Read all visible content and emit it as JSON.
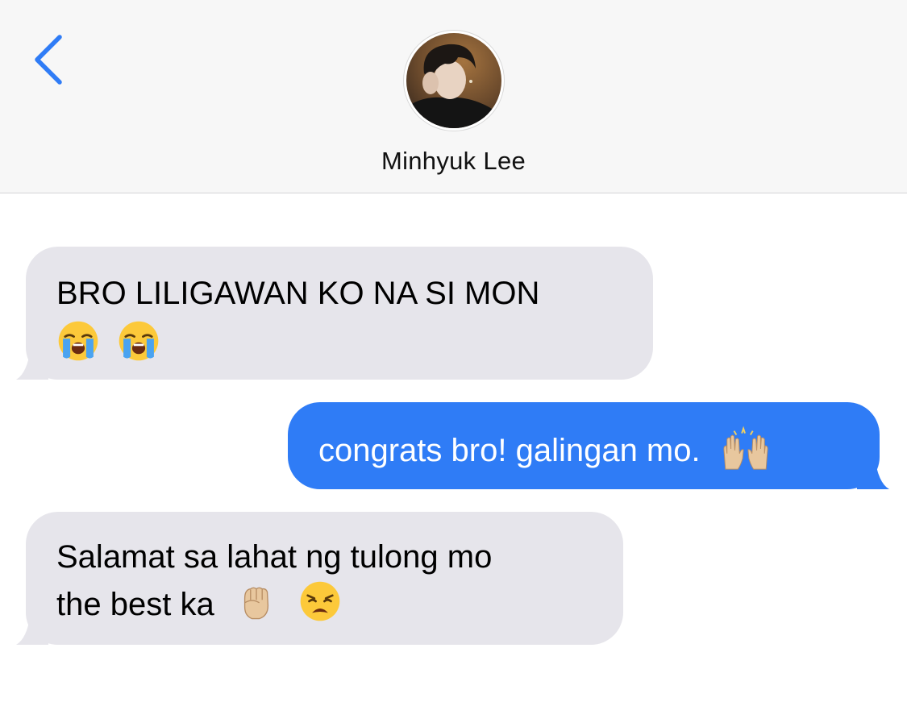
{
  "header": {
    "back_icon": "chevron-left-icon",
    "contact_name": "Minhyuk Lee",
    "avatar_icon": "contact-avatar-photo"
  },
  "colors": {
    "header_bg": "#f7f7f7",
    "received_bubble": "#e6e5eb",
    "sent_bubble": "#2f7cf6",
    "accent": "#2f7cf6"
  },
  "messages": [
    {
      "direction": "received",
      "line1": "BRO LILIGAWAN KO NA SI MON",
      "emojis": [
        "loudly-crying-face-emoji",
        "loudly-crying-face-emoji"
      ]
    },
    {
      "direction": "sent",
      "text": "congrats bro! galingan mo.",
      "emojis": [
        "raising-hands-emoji"
      ]
    },
    {
      "direction": "received",
      "line1": "Salamat sa lahat ng tulong mo",
      "line2": "the best ka",
      "emojis": [
        "raised-fist-emoji",
        "weary-face-emoji"
      ]
    }
  ]
}
